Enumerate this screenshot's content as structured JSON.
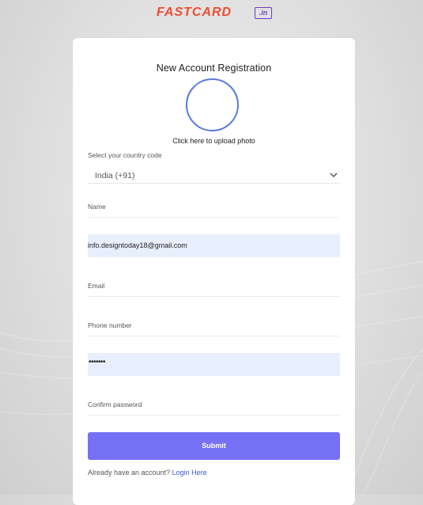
{
  "logo": {
    "text": "FASTCARD",
    "suffix": ".in"
  },
  "form": {
    "title": "New Account Registration",
    "photo_label": "Click here to upload photo",
    "country_label": "Select your country code",
    "country_value": "India (+91)",
    "name_label": "Name",
    "autofill_value": "info.designtoday18@gmail.com",
    "email_label": "Email",
    "phone_label": "Phone number",
    "password_mask": "•••••••",
    "confirm_label": "Confirm password",
    "submit_label": "Submit",
    "login_prompt": "Already have an account?",
    "login_link": "Login Here"
  },
  "colors": {
    "brand": "#ef4d32",
    "brand_badge": "#6a3fc3",
    "submit": "#7670f5",
    "photo_ring": "#5a7be0",
    "autofill_bg": "#e8effc",
    "link": "#3d5bd6"
  }
}
